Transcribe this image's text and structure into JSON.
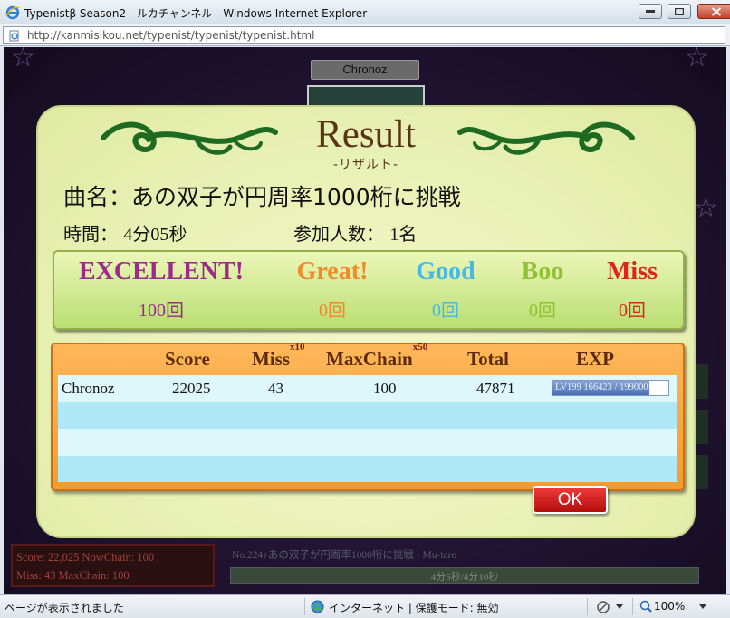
{
  "window": {
    "title": "Typenistβ Season2 - ルカチャンネル - Windows Internet Explorer",
    "url": "http://kanmisikou.net/typenist/typenist/typenist.html"
  },
  "background": {
    "player_tab": "Chronoz",
    "score_line1": "Score: 22,025   NowChain:  100",
    "score_line2": "Miss: 43        MaxChain: 100",
    "track": "No.224♪あの双子が円周率1000桁に挑戦 - Mu-taro",
    "progress_text": "4分5秒/4分10秒"
  },
  "result": {
    "title": "Result",
    "subtitle": "-リザルト-",
    "song_label": "曲名：",
    "song_name": "あの双子が円周率1000桁に挑戦",
    "time_label": "時間：",
    "time_value": "4分05秒",
    "players_label": "参加人数：",
    "players_value": "1名",
    "judges": [
      {
        "label": "EXCELLENT!",
        "count": "100回",
        "color": "#9b2a8a"
      },
      {
        "label": "Great!",
        "count": "0回",
        "color": "#f08a2a"
      },
      {
        "label": "Good",
        "count": "0回",
        "color": "#49b8e6"
      },
      {
        "label": "Boo",
        "count": "0回",
        "color": "#8fc234"
      },
      {
        "label": "Miss",
        "count": "0回",
        "color": "#e0241c"
      }
    ],
    "table": {
      "headers": {
        "score": "Score",
        "miss": "Miss",
        "miss_mult": "x10",
        "maxchain": "MaxChain",
        "maxchain_mult": "x50",
        "total": "Total",
        "exp": "EXP"
      },
      "rows": [
        {
          "name": "Chronoz",
          "score": "22025",
          "miss": "43",
          "maxchain": "100",
          "total": "47871",
          "exp_text": "LV199   166423 / 199000",
          "exp_fraction": 0.836
        }
      ]
    },
    "ok_label": "OK"
  },
  "statusbar": {
    "left": "ページが表示されました",
    "zone": "インターネット | 保護モード: 無効",
    "zoom": "100%"
  }
}
